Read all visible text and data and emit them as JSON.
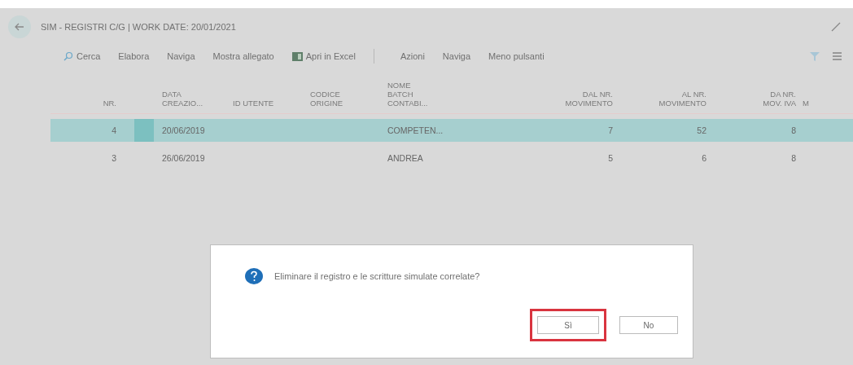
{
  "page": {
    "title": "SIM - REGISTRI C/G | WORK DATE: 20/01/2021"
  },
  "toolbar": [
    {
      "label": "Cerca",
      "kind": "search"
    },
    {
      "label": "Elabora",
      "kind": "text"
    },
    {
      "label": "Naviga",
      "kind": "text"
    },
    {
      "label": "Mostra allegato",
      "kind": "text"
    },
    {
      "label": "Apri in Excel",
      "kind": "excel"
    },
    {
      "label": "Azioni",
      "kind": "separated"
    },
    {
      "label": "Naviga",
      "kind": "text"
    },
    {
      "label": "Meno pulsanti",
      "kind": "text"
    }
  ],
  "table": {
    "columns": [
      {
        "header": "NR."
      },
      {
        "header": "DATA\nCREAZIO..."
      },
      {
        "header": "ID UTENTE"
      },
      {
        "header": "CODICE\nORIGINE"
      },
      {
        "header": "NOME\nBATCH\nCONTABI..."
      },
      {
        "header": "DAL NR.\nMOVIMENTO"
      },
      {
        "header": "AL NR.\nMOVIMENTO"
      },
      {
        "header": "DA NR.\nMOV. IVA"
      },
      {
        "header": "M"
      }
    ],
    "rows": [
      {
        "selected": true,
        "cells": [
          "4",
          "20/06/2019",
          "",
          "",
          "COMPETEN...",
          "7",
          "52",
          "8",
          ""
        ]
      },
      {
        "selected": false,
        "cells": [
          "3",
          "26/06/2019",
          "",
          "",
          "ANDREA",
          "5",
          "6",
          "8",
          ""
        ]
      }
    ]
  },
  "dialog": {
    "message": "Eliminare il registro e le scritture simulate correlate?",
    "buttons": [
      {
        "label": "Sì",
        "highlighted": true
      },
      {
        "label": "No",
        "highlighted": false
      }
    ]
  }
}
